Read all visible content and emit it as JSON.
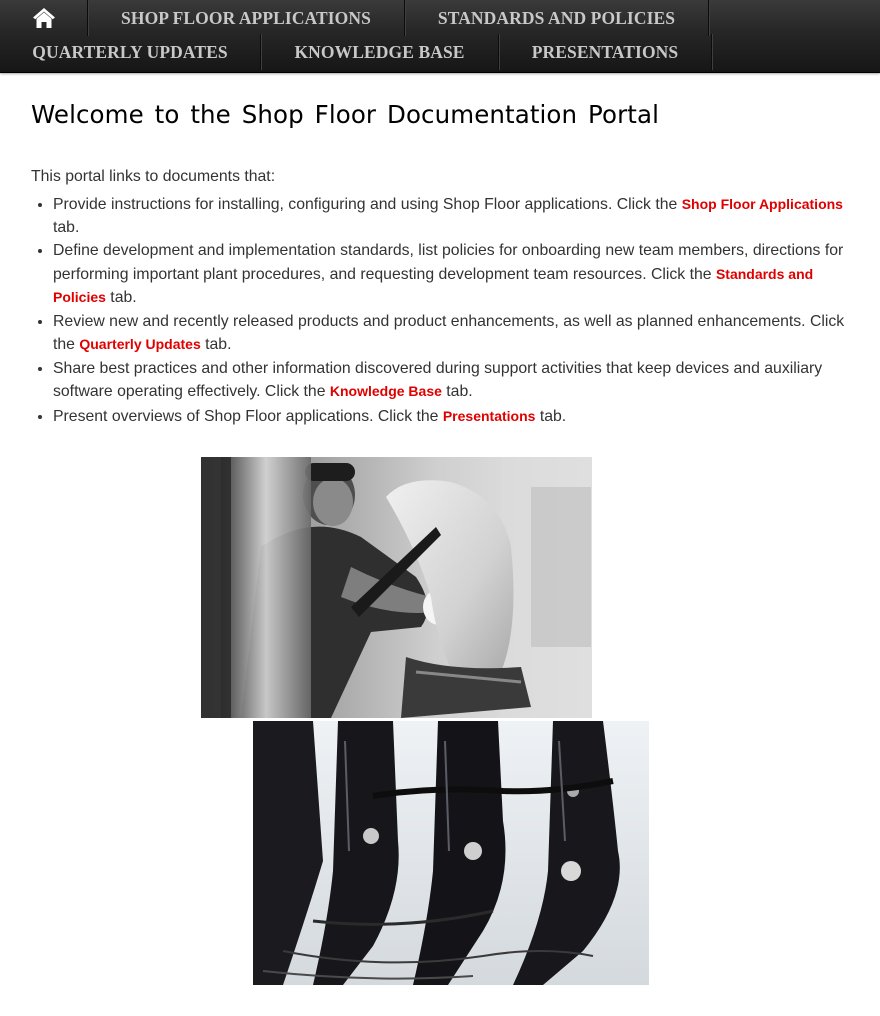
{
  "nav": {
    "home_icon": "home-icon",
    "row1": [
      "SHOP FLOOR APPLICATIONS",
      "STANDARDS AND POLICIES"
    ],
    "row2": [
      "QUARTERLY UPDATES",
      "KNOWLEDGE BASE",
      "PRESENTATIONS"
    ]
  },
  "page": {
    "title": "Welcome to the Shop Floor Documentation Portal",
    "intro": "This portal links to documents that:",
    "bullets": [
      {
        "before": "Provide instructions for installing, configuring and using Shop Floor applications. Click the ",
        "link": "Shop Floor Applications",
        "after": " tab."
      },
      {
        "before": "Define development and implementation standards, list policies for onboarding new team members, directions for performing important plant procedures, and requesting development team resources. Click the ",
        "link": "Standards and Policies",
        "after": " tab."
      },
      {
        "before": "Review new and recently released products and product enhancements, as well as planned enhancements. Click the ",
        "link": "Quarterly Updates",
        "after": " tab."
      },
      {
        "before": "Share best practices and other information discovered during support activities that keep devices and auxiliary software operating effectively. Click the ",
        "link": "Knowledge Base",
        "after": " tab."
      },
      {
        "before": "Present overviews of Shop Floor applications. Click the ",
        "link": "Presentations",
        "after": " tab."
      }
    ]
  },
  "images": [
    {
      "name": "worker-assembling-seat-photo"
    },
    {
      "name": "seat-frames-photo"
    }
  ],
  "colors": {
    "link_red": "#e00000",
    "nav_text": "#c8c8c8",
    "nav_bg": "#262626"
  }
}
